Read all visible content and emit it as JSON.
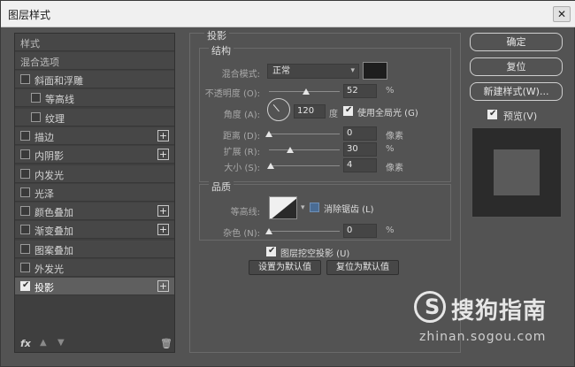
{
  "window": {
    "title": "图层样式"
  },
  "sidebar": {
    "header_styles": "样式",
    "header_blending": "混合选项",
    "items": [
      {
        "label": "斜面和浮雕",
        "checked": false,
        "plus": false,
        "indent": 0
      },
      {
        "label": "等高线",
        "checked": false,
        "plus": false,
        "indent": 1
      },
      {
        "label": "纹理",
        "checked": false,
        "plus": false,
        "indent": 1
      },
      {
        "label": "描边",
        "checked": false,
        "plus": true,
        "indent": 0
      },
      {
        "label": "内阴影",
        "checked": false,
        "plus": true,
        "indent": 0
      },
      {
        "label": "内发光",
        "checked": false,
        "plus": false,
        "indent": 0
      },
      {
        "label": "光泽",
        "checked": false,
        "plus": false,
        "indent": 0
      },
      {
        "label": "颜色叠加",
        "checked": false,
        "plus": true,
        "indent": 0
      },
      {
        "label": "渐变叠加",
        "checked": false,
        "plus": true,
        "indent": 0
      },
      {
        "label": "图案叠加",
        "checked": false,
        "plus": false,
        "indent": 0
      },
      {
        "label": "外发光",
        "checked": false,
        "plus": false,
        "indent": 0
      },
      {
        "label": "投影",
        "checked": true,
        "plus": true,
        "indent": 0,
        "active": true
      }
    ],
    "bottom_icons": [
      "fx-icon",
      "move-up-icon",
      "move-down-icon",
      "trash-icon"
    ],
    "fx_label": "fx"
  },
  "panel": {
    "title": "投影",
    "structure": {
      "title": "结构",
      "blend_mode_label": "混合模式:",
      "blend_mode_value": "正常",
      "shadow_color": "#1e1e1e",
      "opacity_label": "不透明度 (O):",
      "opacity_value": "52",
      "opacity_unit": "%",
      "angle_label": "角度 (A):",
      "angle_value": "120",
      "angle_unit": "度",
      "global_light_label": "使用全局光 (G)",
      "global_light_checked": true,
      "distance_label": "距离 (D):",
      "distance_value": "0",
      "distance_unit": "像素",
      "spread_label": "扩展 (R):",
      "spread_value": "30",
      "spread_unit": "%",
      "size_label": "大小 (S):",
      "size_value": "4",
      "size_unit": "像素"
    },
    "quality": {
      "title": "品质",
      "contour_label": "等高线:",
      "anti_alias_label": "消除锯齿 (L)",
      "anti_alias_checked": false,
      "noise_label": "杂色 (N):",
      "noise_value": "0",
      "noise_unit": "%"
    },
    "knockout_label": "图层挖空投影 (U)",
    "knockout_checked": true,
    "set_default_label": "设置为默认值",
    "reset_default_label": "复位为默认值"
  },
  "actions": {
    "ok_label": "确定",
    "reset_label": "复位",
    "new_style_label": "新建样式(W)...",
    "preview_label": "预览(V)",
    "preview_checked": true
  },
  "watermark": {
    "name": "搜狗指南",
    "url": "zhinan.sogou.com"
  }
}
